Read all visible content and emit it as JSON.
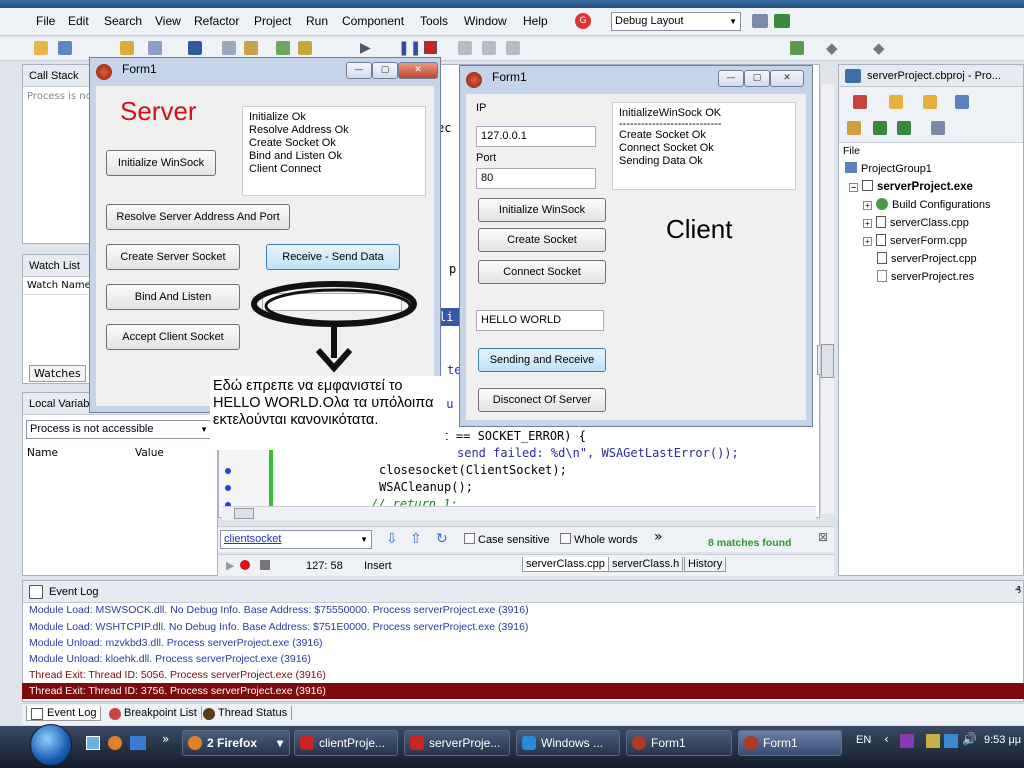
{
  "ide": {
    "menu": [
      "File",
      "Edit",
      "Search",
      "View",
      "Refactor",
      "Project",
      "Run",
      "Component",
      "Tools",
      "Window",
      "Help"
    ],
    "layout_select": "Debug Layout"
  },
  "left_panels": {
    "call_stack_title": "Call Stack",
    "call_stack_msg": "Process is not accessible",
    "watch_title": "Watch List",
    "watch_col": "Watch Name",
    "watches_tab": "Watches",
    "local_title": "Local Variables",
    "local_select": "Process is not accessible",
    "local_col_name": "Name",
    "local_col_value": "Value"
  },
  "server_form": {
    "title": "Form1",
    "heading": "Server",
    "log": [
      "Initialize Ok",
      "Resolve Address Ok",
      "Create Socket Ok",
      "Bind and Listen Ok",
      "Client Connect"
    ],
    "btn_init": "Initialize WinSock",
    "btn_resolve": "Resolve Server Address And Port",
    "btn_create": "Create Server Socket",
    "btn_receive": "Receive - Send Data",
    "btn_bind": "Bind And Listen",
    "btn_accept": "Accept Client Socket"
  },
  "client_form": {
    "title": "Form1",
    "ip_label": "IP",
    "ip_value": "127.0.0.1",
    "port_label": "Port",
    "port_value": "80",
    "log_lines": [
      "InitializeWinSock OK",
      "----------------------------",
      "Create Socket Ok",
      "Connect Socket Ok",
      "Sending Data Ok"
    ],
    "heading": "Client",
    "btn_init": "Initialize WinSock",
    "btn_create": "Create Socket",
    "btn_connect": "Connect Socket",
    "message": "HELLO WORLD",
    "btn_send": "Sending and Receive",
    "btn_disconnect": "Disconect Of  Server"
  },
  "annotation": {
    "text": "Εδώ επρεπε να εμφανιστεί το HELLO WORLD.Ολα τα υπόλοιπα εκτελούνται κανονικότατα."
  },
  "code": {
    "lines": [
      "ult == SOCKET_ERROR) {",
      "send failed: %d\\n\", WSAGetLastError());",
      "closesocket(ClientSocket);",
      "WSACleanup();",
      "// return 1;"
    ],
    "peek_fragments": [
      "ec",
      "p",
      "li",
      "te",
      "bu"
    ]
  },
  "search_bar": {
    "query": "clientsocket",
    "case_label": "Case sensitive",
    "whole_label": "Whole words",
    "matches": "8 matches found"
  },
  "status_bar": {
    "position": "127: 58",
    "mode": "Insert",
    "tabs": [
      "serverClass.cpp",
      "serverClass.h",
      "History"
    ]
  },
  "project": {
    "title": "serverProject.cbproj - Pro...",
    "file_col": "File",
    "items": [
      "ProjectGroup1",
      "serverProject.exe",
      "Build Configurations",
      "serverClass.cpp",
      "serverForm.cpp",
      "serverProject.cpp",
      "serverProject.res"
    ]
  },
  "event_log": {
    "title": "Event Log",
    "lines": [
      "Module Load: MSWSOCK.dll. No Debug Info. Base Address: $75550000. Process serverProject.exe (3916)",
      "Module Load: WSHTCPIP.dll. No Debug Info. Base Address: $751E0000. Process serverProject.exe (3916)",
      "Module Unload: mzvkbd3.dll. Process serverProject.exe (3916)",
      "Module Unload: kloehk.dll. Process serverProject.exe (3916)",
      "Thread Exit: Thread ID: 5056. Process serverProject.exe (3916)",
      "Thread Exit: Thread ID: 3756. Process serverProject.exe (3916)"
    ],
    "tabs": [
      "Event Log",
      "Breakpoint List",
      "Thread Status"
    ]
  },
  "taskbar": {
    "items": [
      "2 Firefox",
      "clientProje...",
      "serverProje...",
      "Windows ...",
      "Form1",
      "Form1"
    ],
    "lang": "EN",
    "clock": "9:53 μμ"
  },
  "colors": {
    "highlight": "#7d0b0b",
    "accent": "#3c7fb1",
    "server_red": "#d0121b"
  }
}
